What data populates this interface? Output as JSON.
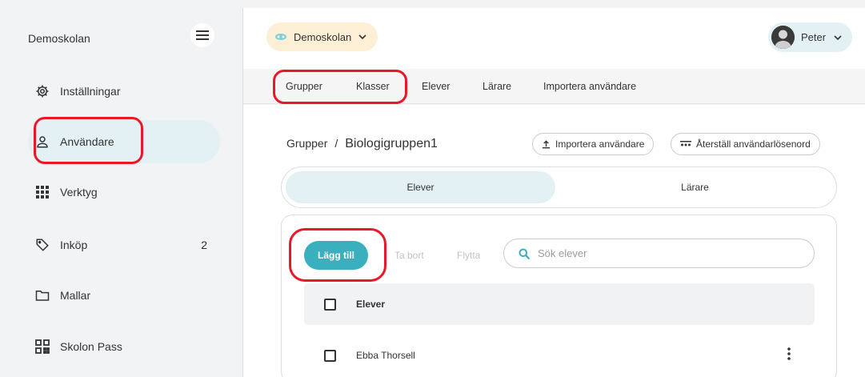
{
  "sidebar": {
    "school_name": "Demoskolan",
    "items": [
      {
        "label": "Inställningar",
        "icon": "gear-icon"
      },
      {
        "label": "Användare",
        "icon": "user-icon",
        "active": true
      },
      {
        "label": "Verktyg",
        "icon": "grid-icon"
      },
      {
        "label": "Inköp",
        "icon": "tag-icon",
        "badge": "2"
      },
      {
        "label": "Mallar",
        "icon": "folder-icon"
      },
      {
        "label": "Skolon Pass",
        "icon": "qr-icon"
      }
    ]
  },
  "header": {
    "school_selector": "Demoskolan",
    "user_name": "Peter"
  },
  "top_tabs": [
    "Grupper",
    "Klasser",
    "Elever",
    "Lärare",
    "Importera användare"
  ],
  "breadcrumb": {
    "parent": "Grupper",
    "separator": "/",
    "current": "Biologigruppen1"
  },
  "actions": {
    "import_users": "Importera användare",
    "reset_passwords": "Återställ användarlösenord"
  },
  "segments": {
    "students": "Elever",
    "teachers": "Lärare"
  },
  "toolbar": {
    "add": "Lägg till",
    "remove": "Ta bort",
    "move": "Flytta",
    "search_placeholder": "Sök elever"
  },
  "table": {
    "header": "Elever",
    "rows": [
      {
        "name": "Ebba Thorsell"
      }
    ]
  },
  "colors": {
    "accent": "#3ab0bf",
    "active_bg": "#e3f1f4",
    "school_pill_bg": "#fcefd6",
    "annotation_red": "#e8182a"
  }
}
